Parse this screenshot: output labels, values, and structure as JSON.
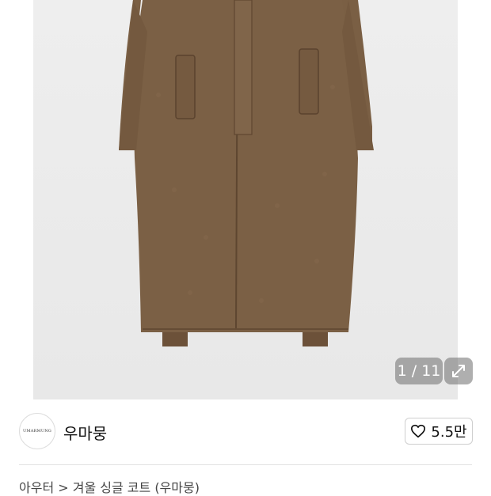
{
  "gallery": {
    "counter": "1 / 11",
    "expand_icon": "expand-arrows-icon"
  },
  "seller": {
    "logo_text": "UMARMUNG",
    "name": "우마뭉"
  },
  "like": {
    "icon": "heart-outline-icon",
    "count": "5.5만"
  },
  "breadcrumb": "아우터 > 겨울 싱글 코트 (우마뭉)",
  "colors": {
    "coat": "#7b6045",
    "photo_bg": "#ececec",
    "badge_bg": "#6e6e6e"
  }
}
